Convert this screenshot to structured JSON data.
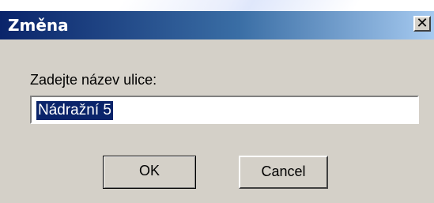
{
  "dialog": {
    "title": "Změna",
    "close_glyph": "✕",
    "close_icon": "close-icon"
  },
  "prompt": {
    "label": "Zadejte název ulice:",
    "input_value": "Nádražní 5"
  },
  "buttons": {
    "ok_label": "OK",
    "cancel_label": "Cancel"
  },
  "colors": {
    "title_bar_start": "#0a246a",
    "title_bar_end": "#a6caf0",
    "dialog_face": "#d4d0c8",
    "selection": "#0a246a"
  }
}
